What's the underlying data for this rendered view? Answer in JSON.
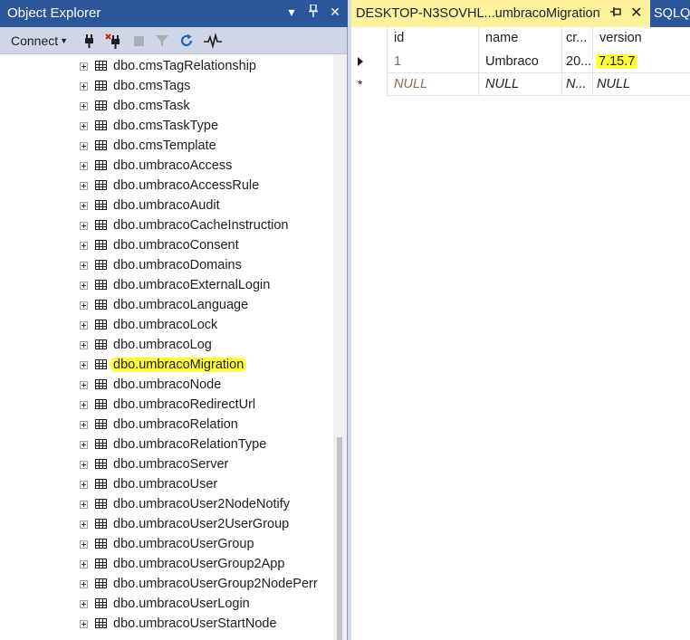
{
  "object_explorer": {
    "title": "Object Explorer",
    "title_buttons": [
      "chevron-down-icon",
      "pin-icon",
      "close-icon"
    ],
    "toolbar": {
      "connect_label": "Connect",
      "icons": [
        "connect-plug-icon",
        "disconnect-plug-icon",
        "stop-icon",
        "filter-icon",
        "refresh-icon",
        "activity-monitor-icon"
      ]
    },
    "tables": [
      "dbo.cmsTagRelationship",
      "dbo.cmsTags",
      "dbo.cmsTask",
      "dbo.cmsTaskType",
      "dbo.cmsTemplate",
      "dbo.umbracoAccess",
      "dbo.umbracoAccessRule",
      "dbo.umbracoAudit",
      "dbo.umbracoCacheInstruction",
      "dbo.umbracoConsent",
      "dbo.umbracoDomains",
      "dbo.umbracoExternalLogin",
      "dbo.umbracoLanguage",
      "dbo.umbracoLock",
      "dbo.umbracoLog",
      "dbo.umbracoMigration",
      "dbo.umbracoNode",
      "dbo.umbracoRedirectUrl",
      "dbo.umbracoRelation",
      "dbo.umbracoRelationType",
      "dbo.umbracoServer",
      "dbo.umbracoUser",
      "dbo.umbracoUser2NodeNotify",
      "dbo.umbracoUser2UserGroup",
      "dbo.umbracoUserGroup",
      "dbo.umbracoUserGroup2App",
      "dbo.umbracoUserGroup2NodePerr",
      "dbo.umbracoUserLogin",
      "dbo.umbracoUserStartNode"
    ],
    "highlighted_table": "dbo.umbracoMigration"
  },
  "document": {
    "active_tab": "DESKTOP-N3SOVHL...umbracoMigration",
    "other_tab": "SQLQ",
    "grid": {
      "columns": [
        "id",
        "name",
        "cr...",
        "version"
      ],
      "rows": [
        [
          "1",
          "Umbraco",
          "20...",
          "7.15.7"
        ],
        [
          "NULL",
          "NULL",
          "N...",
          "NULL"
        ]
      ]
    }
  },
  "colors": {
    "title_bar": "#2b579a",
    "active_tab": "#fff29d",
    "highlight": "#ffff3c"
  }
}
